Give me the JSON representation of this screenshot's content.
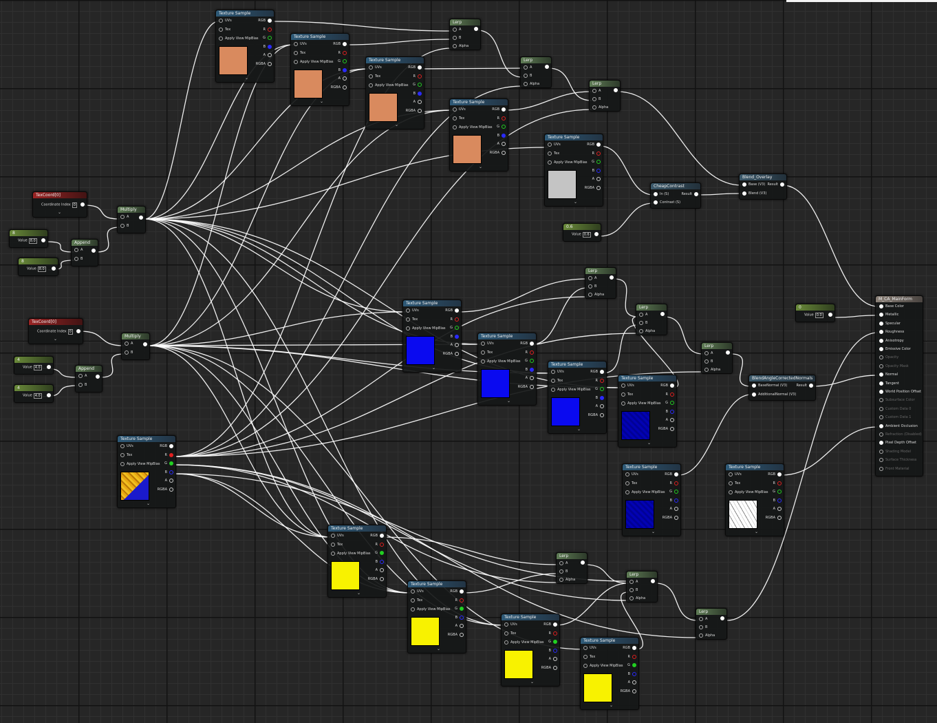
{
  "labels": {
    "texture_sample": "Texture Sample",
    "lerp": "Lerp",
    "multiply": "Multiply",
    "append": "Append",
    "texcoord": "TexCoord[0]",
    "coordinate_index": "Coordinate Index",
    "value": "Value",
    "uvs": "UVs",
    "tex": "Tex",
    "apply_view_mipbias": "Apply View MipBias",
    "rgb": "RGB",
    "r": "R",
    "g": "G",
    "b": "B",
    "a": "A",
    "rgba": "RGBA",
    "pin_a": "A",
    "pin_b": "B",
    "alpha": "Alpha",
    "cheap_contrast": "CheapContrast",
    "in_s": "In (S)",
    "contrast_s": "Contrast (S)",
    "result": "Result",
    "blend_overlay": "Blend_Overlay",
    "base_v3": "Base (V3)",
    "blend_v3": "Blend (V3)",
    "blend_angle": "BlendAngleCorrectedNormals",
    "base_normal": "BaseNormal (V3)",
    "additional_normal": "AdditionalNormal (V3)",
    "zero": "0"
  },
  "texcoord_nodes": [
    {
      "coordinate_index": "0"
    },
    {
      "coordinate_index": "0"
    }
  ],
  "constant_nodes": [
    {
      "title": "8",
      "value": "8.0"
    },
    {
      "title": "8",
      "value": "8.0"
    },
    {
      "title": "4",
      "value": "4.0"
    },
    {
      "title": "4",
      "value": "4.0"
    },
    {
      "title": "0.6",
      "value": "0.6"
    },
    {
      "title": "0",
      "value": "0.0"
    }
  ],
  "material": {
    "title": "M_CA_MainForm",
    "inputs": [
      {
        "label": "Base Color",
        "active": true
      },
      {
        "label": "Metallic",
        "active": true
      },
      {
        "label": "Specular",
        "active": true
      },
      {
        "label": "Roughness",
        "active": true
      },
      {
        "label": "Anisotropy",
        "active": true
      },
      {
        "label": "Emissive Color",
        "active": true
      },
      {
        "label": "Opacity",
        "active": false
      },
      {
        "label": "Opacity Mask",
        "active": false
      },
      {
        "label": "Normal",
        "active": true
      },
      {
        "label": "Tangent",
        "active": true
      },
      {
        "label": "World Position Offset",
        "active": true
      },
      {
        "label": "Subsurface Color",
        "active": false
      },
      {
        "label": "Custom Data 0",
        "active": false
      },
      {
        "label": "Custom Data 1",
        "active": false
      },
      {
        "label": "Ambient Occlusion",
        "active": true
      },
      {
        "label": "Refraction (Disabled)",
        "active": false
      },
      {
        "label": "Pixel Depth Offset",
        "active": true
      },
      {
        "label": "Shading Model",
        "active": false
      },
      {
        "label": "Surface Thickness",
        "active": false
      },
      {
        "label": "Front Material",
        "active": false
      }
    ]
  },
  "colors": {
    "background": "#262626",
    "texture_header": "#2e5a78",
    "lerp_header": "#5f7c55",
    "texcoord_header": "#9a2424",
    "constant_header": "#6a8a3a",
    "material_header": "#8b8178",
    "wire": "#ffffff",
    "swatch_orange": "#d98a5e",
    "swatch_blue": "#0a0af0",
    "swatch_yellow": "#f8f200",
    "swatch_gray": "#c4c4c4"
  }
}
